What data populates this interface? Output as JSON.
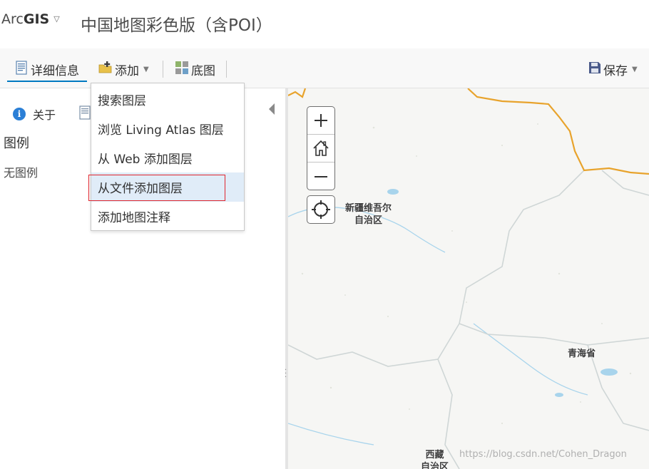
{
  "header": {
    "brand_light": "Arc",
    "brand_bold": "GIS",
    "brand_caret": "▽",
    "map_title": "中国地图彩色版（含POI）"
  },
  "toolbar": {
    "details_label": "详细信息",
    "add_label": "添加",
    "basemap_label": "底图",
    "save_label": "保存",
    "dropdown_caret": "▼"
  },
  "left_panel": {
    "about_label": "关于",
    "legend_title": "图例",
    "legend_empty": "无图例"
  },
  "add_menu": {
    "items": [
      "搜索图层",
      "浏览 Living Atlas 图层",
      "从 Web 添加图层",
      "从文件添加图层",
      "添加地图注释"
    ],
    "highlighted_index": 3
  },
  "map": {
    "labels": {
      "xinjiang_line1": "新疆维吾尔",
      "xinjiang_line2": "自治区",
      "qinghai": "青海省",
      "xizang_line1": "西藏",
      "xizang_line2": "自治区"
    },
    "colors": {
      "national_border": "#e8a32c",
      "province_border": "#cfd6d6",
      "water": "#a8d4ec"
    }
  },
  "watermark": "https://blog.csdn.net/Cohen_Dragon",
  "colors": {
    "accent": "#0079c1",
    "highlight_bg": "#e0ecf8",
    "annotation_red": "#e0262e"
  }
}
